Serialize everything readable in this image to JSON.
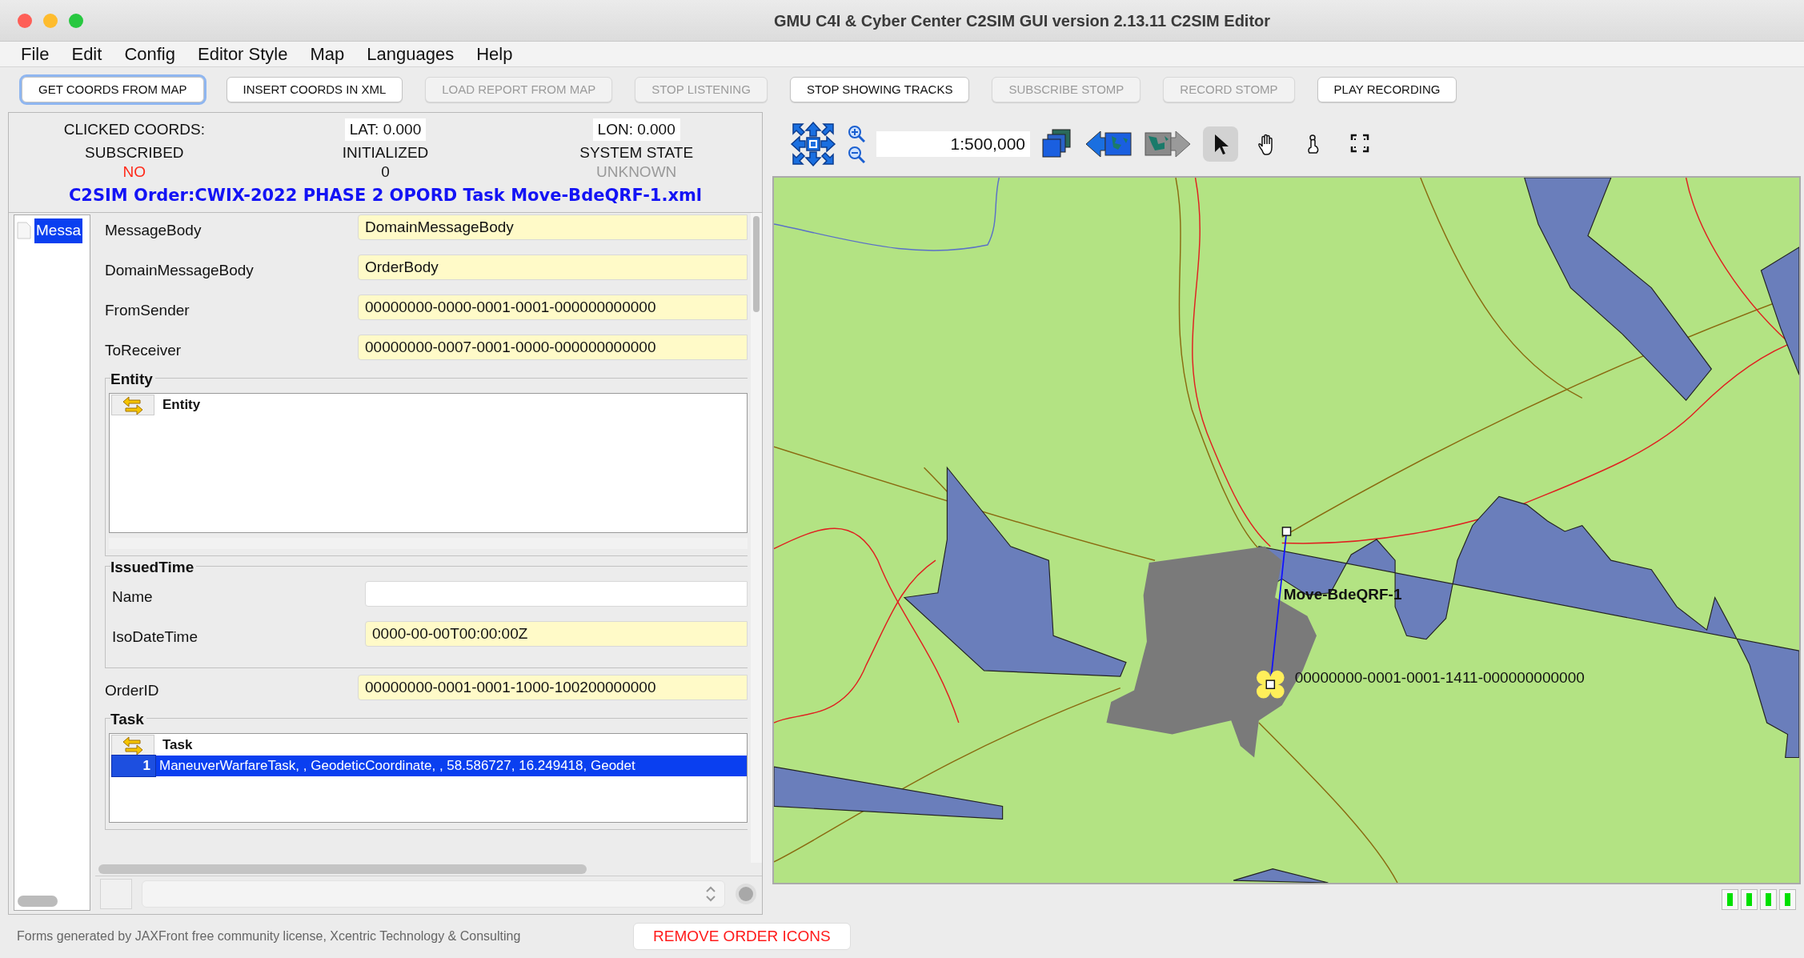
{
  "window": {
    "title": "GMU C4I & Cyber Center C2SIM GUI version 2.13.11 C2SIM Editor"
  },
  "menu": [
    "File",
    "Edit",
    "Config",
    "Editor Style",
    "Map",
    "Languages",
    "Help"
  ],
  "toolbar_buttons": [
    {
      "label": "GET COORDS FROM MAP",
      "disabled": false,
      "focused": true
    },
    {
      "label": "INSERT COORDS IN XML",
      "disabled": false,
      "focused": false
    },
    {
      "label": "LOAD REPORT FROM MAP",
      "disabled": true,
      "focused": false
    },
    {
      "label": "STOP LISTENING",
      "disabled": true,
      "focused": false
    },
    {
      "label": "STOP SHOWING TRACKS",
      "disabled": false,
      "focused": false
    },
    {
      "label": "SUBSCRIBE STOMP",
      "disabled": true,
      "focused": false
    },
    {
      "label": "RECORD STOMP",
      "disabled": true,
      "focused": false
    },
    {
      "label": "PLAY RECORDING",
      "disabled": false,
      "focused": false
    }
  ],
  "status_panel": {
    "clicked_coords_label": "CLICKED COORDS:",
    "lat": "LAT:  0.000",
    "lon": "LON:  0.000",
    "indicators": [
      {
        "label": "SUBSCRIBED",
        "value": "NO",
        "color": "#ff2a1a"
      },
      {
        "label": "INITIALIZED",
        "value": "0",
        "color": "#111111"
      },
      {
        "label": "SYSTEM STATE",
        "value": "UNKNOWN",
        "color": "#9a9a9a"
      }
    ],
    "order_title": "C2SIM Order:CWIX-2022 PHASE 2 OPORD Task Move-BdeQRF-1.xml"
  },
  "tree": [
    {
      "label": "Messa",
      "selected": true
    }
  ],
  "form": [
    {
      "kind": "field",
      "label": "MessageBody",
      "value": "DomainMessageBody",
      "required": true
    },
    {
      "kind": "field",
      "label": "DomainMessageBody",
      "value": "OrderBody",
      "required": true
    },
    {
      "kind": "field",
      "label": "FromSender",
      "value": "00000000-0000-0001-0001-000000000000",
      "required": true
    },
    {
      "kind": "field",
      "label": "ToReceiver",
      "value": "00000000-0007-0001-0000-000000000000",
      "required": true
    },
    {
      "kind": "table",
      "title": "Entity",
      "header": "Entity"
    },
    {
      "kind": "group",
      "title": "IssuedTime",
      "fields": [
        {
          "label": "Name",
          "required": false
        },
        {
          "label": "IsoDateTime",
          "value": "0000-00-00T00:00:00Z",
          "required": true
        }
      ]
    },
    {
      "kind": "field",
      "label": "OrderID",
      "value": "00000000-0001-0001-1000-100200000000",
      "required": true
    },
    {
      "kind": "table",
      "title": "Task",
      "header": "Task",
      "rows": [
        {
          "index": "1",
          "text": "ManeuverWarfareTask, , GeodeticCoordinate, , 58.586727, 16.249418, Geodet",
          "selected": true
        }
      ]
    }
  ],
  "map": {
    "scale": "1:500,000",
    "tools": [
      {
        "kind": "pointer",
        "selected": true
      },
      {
        "kind": "hand",
        "selected": false
      },
      {
        "kind": "touch",
        "selected": false
      },
      {
        "kind": "fullscreen",
        "selected": false
      }
    ],
    "route_label": "Move-BdeQRF-1",
    "unit_label": "00000000-0001-0001-1411-000000000000"
  },
  "footer": {
    "text": "Forms generated by JAXFront free community license, Xcentric Technology & Consulting",
    "button": "REMOVE ORDER ICONS"
  }
}
